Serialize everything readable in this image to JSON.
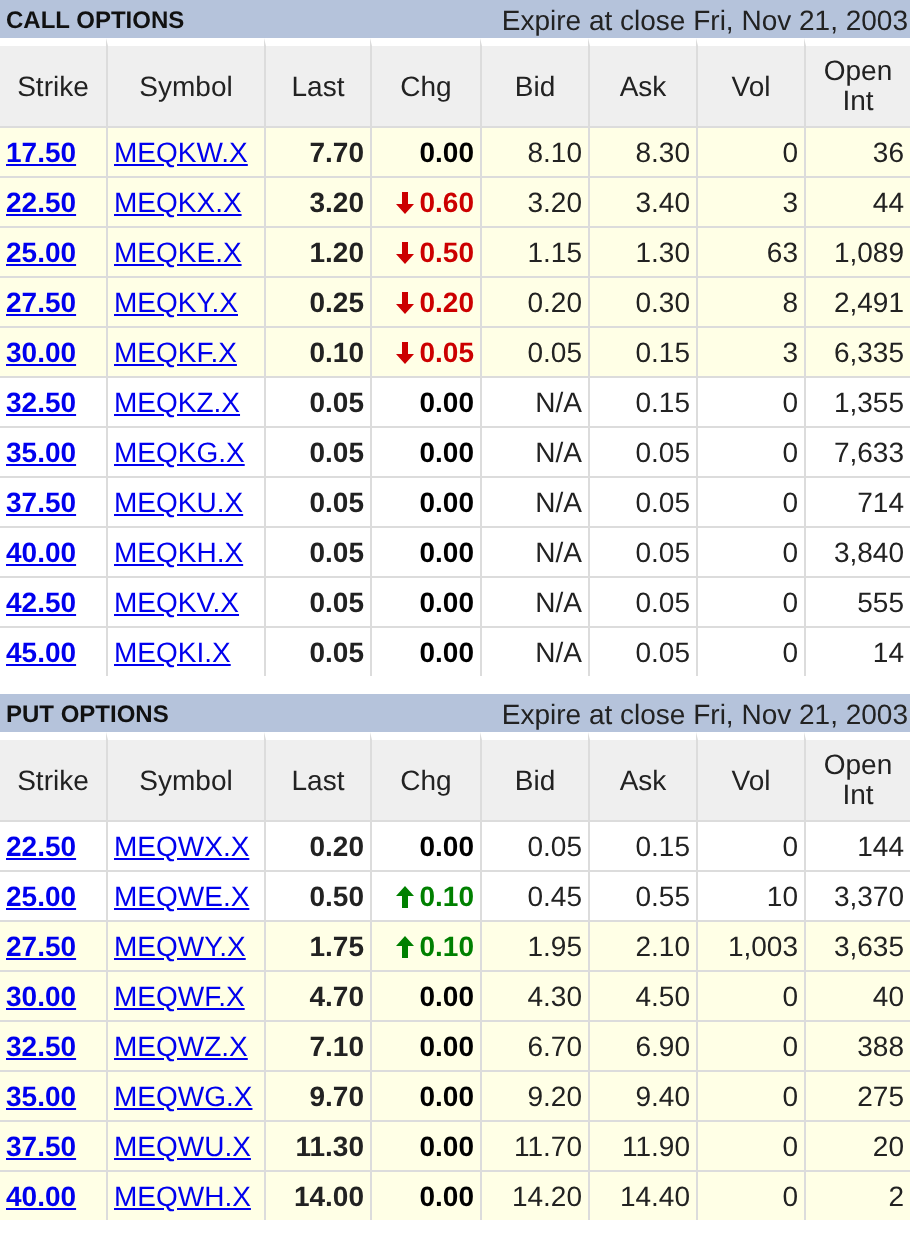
{
  "sections": [
    {
      "title": "CALL OPTIONS",
      "expiry": "Expire at close Fri, Nov 21, 2003",
      "columns": [
        "Strike",
        "Symbol",
        "Last",
        "Chg",
        "Bid",
        "Ask",
        "Vol",
        "Open Int"
      ],
      "rows": [
        {
          "strike": "17.50",
          "symbol": "MEQKW.X",
          "last": "7.70",
          "chg": "0.00",
          "rising": false,
          "falling": false,
          "bid": "8.10",
          "ask": "8.30",
          "vol": "0",
          "open_int": "36",
          "in_the_money": true
        },
        {
          "strike": "22.50",
          "symbol": "MEQKX.X",
          "last": "3.20",
          "chg": "0.60",
          "rising": false,
          "falling": true,
          "bid": "3.20",
          "ask": "3.40",
          "vol": "3",
          "open_int": "44",
          "in_the_money": true
        },
        {
          "strike": "25.00",
          "symbol": "MEQKE.X",
          "last": "1.20",
          "chg": "0.50",
          "rising": false,
          "falling": true,
          "bid": "1.15",
          "ask": "1.30",
          "vol": "63",
          "open_int": "1,089",
          "in_the_money": true
        },
        {
          "strike": "27.50",
          "symbol": "MEQKY.X",
          "last": "0.25",
          "chg": "0.20",
          "rising": false,
          "falling": true,
          "bid": "0.20",
          "ask": "0.30",
          "vol": "8",
          "open_int": "2,491",
          "in_the_money": true
        },
        {
          "strike": "30.00",
          "symbol": "MEQKF.X",
          "last": "0.10",
          "chg": "0.05",
          "rising": false,
          "falling": true,
          "bid": "0.05",
          "ask": "0.15",
          "vol": "3",
          "open_int": "6,335",
          "in_the_money": true
        },
        {
          "strike": "32.50",
          "symbol": "MEQKZ.X",
          "last": "0.05",
          "chg": "0.00",
          "rising": false,
          "falling": false,
          "bid": "N/A",
          "ask": "0.15",
          "vol": "0",
          "open_int": "1,355",
          "in_the_money": false
        },
        {
          "strike": "35.00",
          "symbol": "MEQKG.X",
          "last": "0.05",
          "chg": "0.00",
          "rising": false,
          "falling": false,
          "bid": "N/A",
          "ask": "0.05",
          "vol": "0",
          "open_int": "7,633",
          "in_the_money": false
        },
        {
          "strike": "37.50",
          "symbol": "MEQKU.X",
          "last": "0.05",
          "chg": "0.00",
          "rising": false,
          "falling": false,
          "bid": "N/A",
          "ask": "0.05",
          "vol": "0",
          "open_int": "714",
          "in_the_money": false
        },
        {
          "strike": "40.00",
          "symbol": "MEQKH.X",
          "last": "0.05",
          "chg": "0.00",
          "rising": false,
          "falling": false,
          "bid": "N/A",
          "ask": "0.05",
          "vol": "0",
          "open_int": "3,840",
          "in_the_money": false
        },
        {
          "strike": "42.50",
          "symbol": "MEQKV.X",
          "last": "0.05",
          "chg": "0.00",
          "rising": false,
          "falling": false,
          "bid": "N/A",
          "ask": "0.05",
          "vol": "0",
          "open_int": "555",
          "in_the_money": false
        },
        {
          "strike": "45.00",
          "symbol": "MEQKI.X",
          "last": "0.05",
          "chg": "0.00",
          "rising": false,
          "falling": false,
          "bid": "N/A",
          "ask": "0.05",
          "vol": "0",
          "open_int": "14",
          "in_the_money": false
        }
      ]
    },
    {
      "title": "PUT OPTIONS",
      "expiry": "Expire at close Fri, Nov 21, 2003",
      "columns": [
        "Strike",
        "Symbol",
        "Last",
        "Chg",
        "Bid",
        "Ask",
        "Vol",
        "Open Int"
      ],
      "rows": [
        {
          "strike": "22.50",
          "symbol": "MEQWX.X",
          "last": "0.20",
          "chg": "0.00",
          "rising": false,
          "falling": false,
          "bid": "0.05",
          "ask": "0.15",
          "vol": "0",
          "open_int": "144",
          "in_the_money": false
        },
        {
          "strike": "25.00",
          "symbol": "MEQWE.X",
          "last": "0.50",
          "chg": "0.10",
          "rising": true,
          "falling": false,
          "bid": "0.45",
          "ask": "0.55",
          "vol": "10",
          "open_int": "3,370",
          "in_the_money": false
        },
        {
          "strike": "27.50",
          "symbol": "MEQWY.X",
          "last": "1.75",
          "chg": "0.10",
          "rising": true,
          "falling": false,
          "bid": "1.95",
          "ask": "2.10",
          "vol": "1,003",
          "open_int": "3,635",
          "in_the_money": true
        },
        {
          "strike": "30.00",
          "symbol": "MEQWF.X",
          "last": "4.70",
          "chg": "0.00",
          "rising": false,
          "falling": false,
          "bid": "4.30",
          "ask": "4.50",
          "vol": "0",
          "open_int": "40",
          "in_the_money": true
        },
        {
          "strike": "32.50",
          "symbol": "MEQWZ.X",
          "last": "7.10",
          "chg": "0.00",
          "rising": false,
          "falling": false,
          "bid": "6.70",
          "ask": "6.90",
          "vol": "0",
          "open_int": "388",
          "in_the_money": true
        },
        {
          "strike": "35.00",
          "symbol": "MEQWG.X",
          "last": "9.70",
          "chg": "0.00",
          "rising": false,
          "falling": false,
          "bid": "9.20",
          "ask": "9.40",
          "vol": "0",
          "open_int": "275",
          "in_the_money": true
        },
        {
          "strike": "37.50",
          "symbol": "MEQWU.X",
          "last": "11.30",
          "chg": "0.00",
          "rising": false,
          "falling": false,
          "bid": "11.70",
          "ask": "11.90",
          "vol": "0",
          "open_int": "20",
          "in_the_money": true
        },
        {
          "strike": "40.00",
          "symbol": "MEQWH.X",
          "last": "14.00",
          "chg": "0.00",
          "rising": false,
          "falling": false,
          "bid": "14.20",
          "ask": "14.40",
          "vol": "0",
          "open_int": "2",
          "in_the_money": true
        }
      ]
    }
  ]
}
